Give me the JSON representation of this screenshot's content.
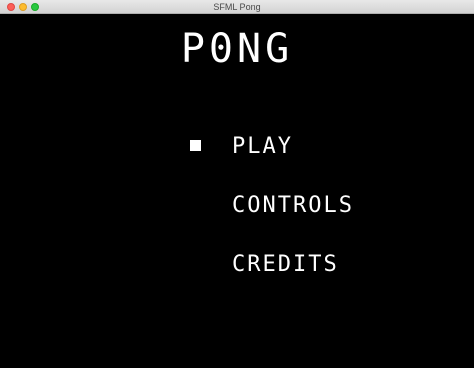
{
  "window": {
    "title": "SFML Pong"
  },
  "game": {
    "title": "P0NG",
    "menu": {
      "items": [
        {
          "label": "PLAY",
          "selected": true
        },
        {
          "label": "CONTROLS",
          "selected": false
        },
        {
          "label": "CREDITS",
          "selected": false
        }
      ],
      "selector_icon": "square-selector-icon"
    }
  },
  "colors": {
    "background": "#000000",
    "text": "#ffffff",
    "close": "#fc5f57",
    "minimize": "#fdbc2e",
    "zoom": "#28c840"
  }
}
